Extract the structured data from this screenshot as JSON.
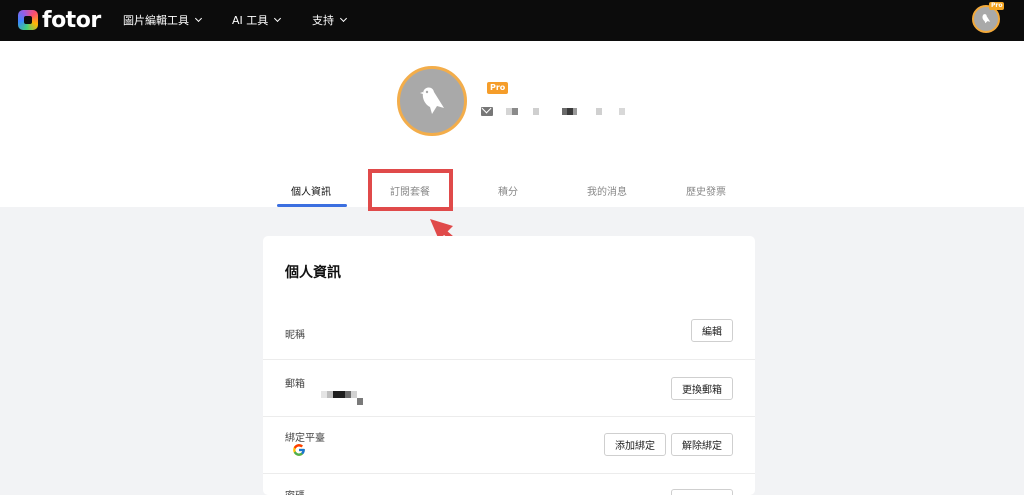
{
  "header": {
    "logo_text": "fotor",
    "nav": [
      {
        "label": "圖片編輯工具"
      },
      {
        "label": "AI 工具"
      },
      {
        "label": "支持"
      }
    ],
    "avatar_badge": "Pro"
  },
  "profile": {
    "pro_badge": "Pro"
  },
  "tabs": [
    {
      "label": "個人資訊",
      "active": true
    },
    {
      "label": "訂閱套餐",
      "active": false
    },
    {
      "label": "積分",
      "active": false
    },
    {
      "label": "我的消息",
      "active": false
    },
    {
      "label": "歷史發票",
      "active": false
    }
  ],
  "card": {
    "title": "個人資訊",
    "rows": [
      {
        "label": "昵稱",
        "buttons": [
          "編輯"
        ]
      },
      {
        "label": "郵箱",
        "buttons": [
          "更換郵箱"
        ]
      },
      {
        "label": "綁定平臺",
        "buttons": [
          "添加綁定",
          "解除綁定"
        ]
      },
      {
        "label": "密碼",
        "buttons": []
      }
    ]
  },
  "colors": {
    "topbar": "#0c0c0c",
    "accent_blue": "#3b6fe0",
    "pro_orange": "#f59d2a",
    "annotation_red": "#e04a4a"
  },
  "icons": [
    "fotor-logo-icon",
    "chevron-down-icon",
    "user-avatar-bird-icon",
    "mail-icon",
    "google-icon",
    "annotation-arrow"
  ]
}
